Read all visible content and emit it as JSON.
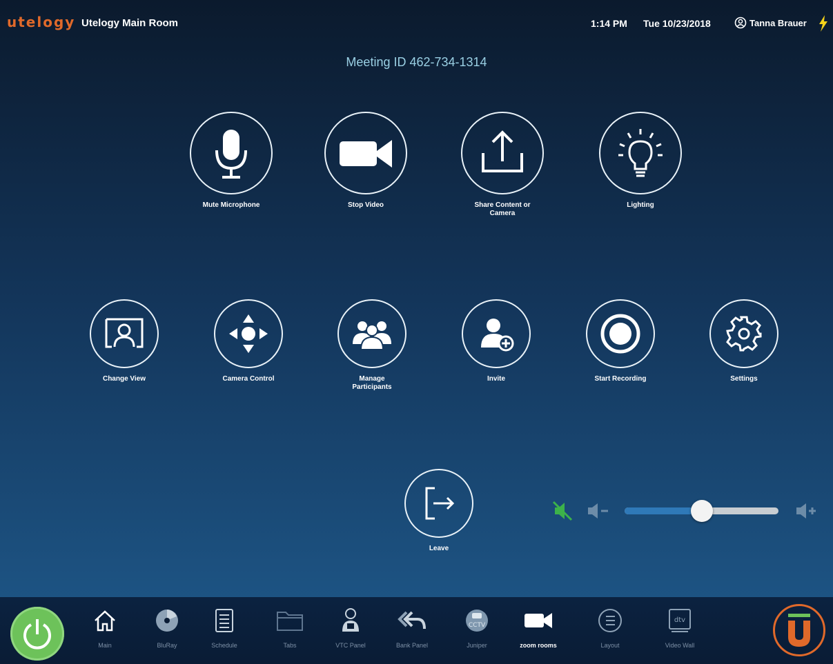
{
  "header": {
    "logo": "utelogy",
    "room_name": "Utelogy Main Room",
    "time": "1:14 PM",
    "date": "Tue 10/23/2018",
    "user": "Tanna Brauer"
  },
  "meeting": {
    "id_text": "Meeting ID 462-734-1314"
  },
  "actions_row1": [
    {
      "label": "Mute Microphone",
      "icon": "microphone-icon"
    },
    {
      "label": "Stop Video",
      "icon": "video-camera-icon"
    },
    {
      "label": "Share Content or Camera",
      "icon": "share-upload-icon"
    },
    {
      "label": "Lighting",
      "icon": "lightbulb-icon"
    }
  ],
  "actions_row2": [
    {
      "label": "Change View",
      "icon": "change-view-icon"
    },
    {
      "label": "Camera Control",
      "icon": "camera-control-icon"
    },
    {
      "label": "Manage Participants",
      "icon": "participants-icon"
    },
    {
      "label": "Invite",
      "icon": "invite-user-icon"
    },
    {
      "label": "Start Recording",
      "icon": "record-icon"
    },
    {
      "label": "Settings",
      "icon": "gear-icon"
    }
  ],
  "leave": {
    "label": "Leave",
    "icon": "exit-icon"
  },
  "volume": {
    "level_percent": 50,
    "muted_icon_color": "#3cb24a"
  },
  "nav": [
    {
      "label": "Main",
      "icon": "home-icon"
    },
    {
      "label": "BluRay",
      "icon": "disc-icon"
    },
    {
      "label": "Schedule",
      "icon": "schedule-list-icon"
    },
    {
      "label": "Tabs",
      "icon": "folder-icon"
    },
    {
      "label": "VTC Panel",
      "icon": "person-badge-icon"
    },
    {
      "label": "Bank Panel",
      "icon": "reply-all-icon"
    },
    {
      "label": "Juniper",
      "icon": "cctv-icon"
    },
    {
      "label": "zoom rooms",
      "icon": "video-camera-icon",
      "active": true
    },
    {
      "label": "Layout",
      "icon": "layout-list-icon"
    },
    {
      "label": "Video Wall",
      "icon": "tv-icon"
    }
  ],
  "colors": {
    "accent_orange": "#e0692a",
    "power_green": "#6dc25a",
    "meeting_id": "#9ad0e4"
  }
}
